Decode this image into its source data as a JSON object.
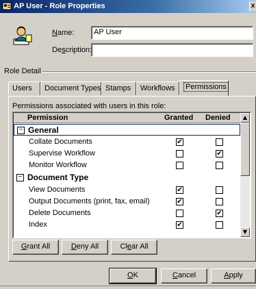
{
  "window": {
    "title": "AP User - Role Properties",
    "close_glyph": "x"
  },
  "form": {
    "name_label": "Name:",
    "name_underline": "N",
    "name_rest": "ame:",
    "name_value": "AP User",
    "description_label": "Description:",
    "description_pre": "De",
    "description_underline": "s",
    "description_post": "cription:",
    "description_value": ""
  },
  "role_detail": {
    "label": "Role Detail"
  },
  "tabs": [
    {
      "label": "Users",
      "active": false
    },
    {
      "label": "Document Types",
      "active": false
    },
    {
      "label": "Stamps",
      "active": false
    },
    {
      "label": "Workflows",
      "active": false
    },
    {
      "label": "Permissions",
      "active": true
    }
  ],
  "permissions": {
    "caption": "Permissions associated with users in this role:",
    "headers": {
      "permission": "Permission",
      "granted": "Granted",
      "denied": "Denied"
    },
    "checked_glyph": "✔",
    "minus_glyph": "−",
    "categories": [
      {
        "name": "General",
        "items": [
          {
            "name": "Collate Documents",
            "granted": true,
            "denied": false
          },
          {
            "name": "Supervise Workflow",
            "granted": false,
            "denied": true
          },
          {
            "name": "Monitor Workflow",
            "granted": false,
            "denied": false
          }
        ]
      },
      {
        "name": "Document Type",
        "items": [
          {
            "name": "View Documents",
            "granted": true,
            "denied": false
          },
          {
            "name": "Output Documents (print, fax, email)",
            "granted": true,
            "denied": false
          },
          {
            "name": "Delete Documents",
            "granted": false,
            "denied": true
          },
          {
            "name": "Index",
            "granted": true,
            "denied": false
          }
        ]
      }
    ]
  },
  "grid_buttons": {
    "grant_all": {
      "u": "G",
      "rest": "rant All"
    },
    "deny_all": {
      "u": "D",
      "rest": "eny All"
    },
    "clear_all": {
      "pre": "Cl",
      "u": "e",
      "rest": "ar All"
    }
  },
  "dialog_buttons": {
    "ok": {
      "u": "O",
      "rest": "K"
    },
    "cancel": {
      "u": "C",
      "rest": "ancel"
    },
    "apply": {
      "u": "A",
      "rest": "pply"
    }
  }
}
